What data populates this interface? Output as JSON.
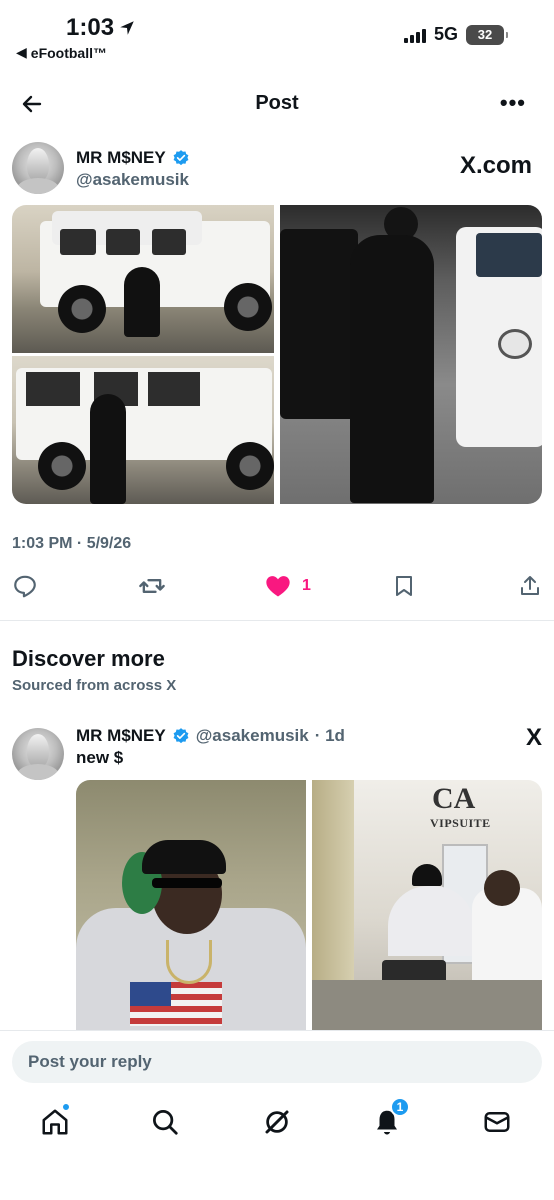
{
  "status_bar": {
    "time": "1:03",
    "back_app": "eFootball™",
    "network": "5G",
    "battery": "32"
  },
  "header": {
    "title": "Post",
    "more_label": "•••"
  },
  "post": {
    "author_name": "MR M$NEY",
    "handle": "@asakemusik",
    "source": "X.com",
    "timestamp": "1:03 PM · 5/9/26",
    "like_count": "1",
    "liked": true
  },
  "discover": {
    "title": "Discover more",
    "subtitle": "Sourced from across X",
    "post": {
      "author_name": "MR M$NEY",
      "handle": "@asakemusik",
      "age": "· 1d",
      "x_mark": "X",
      "text": "new $",
      "photo_logo": "CA",
      "photo_logo_sub": "VIPSUITE"
    }
  },
  "reply": {
    "placeholder": "Post your reply"
  },
  "tabbar": {
    "notifications_badge": "1"
  },
  "colors": {
    "accent": "#1d9bf0",
    "like": "#f91880",
    "muted": "#536471"
  }
}
